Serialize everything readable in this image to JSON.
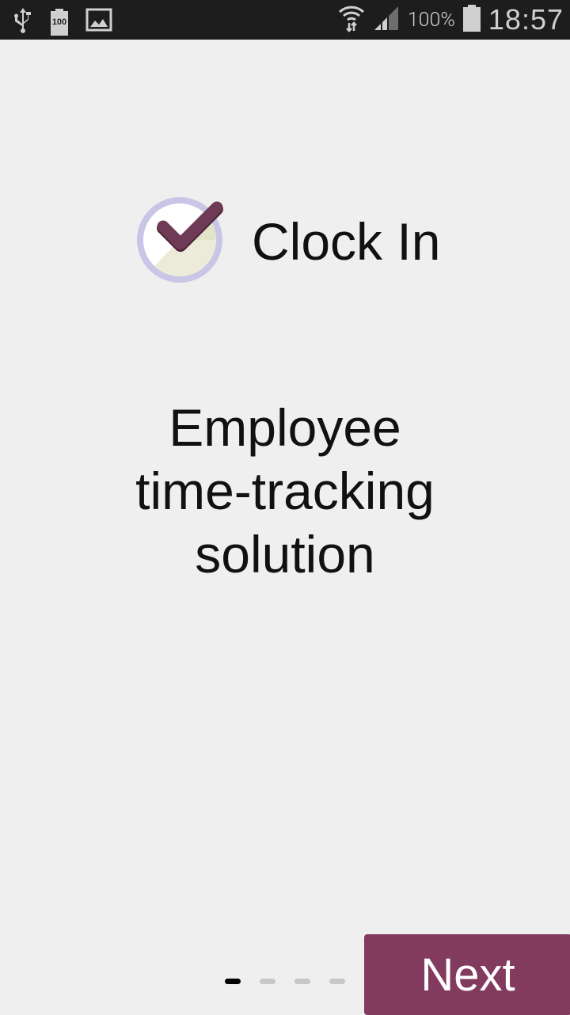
{
  "status_bar": {
    "left_icons": [
      "usb-icon",
      "battery-100-notification-icon",
      "image-icon"
    ],
    "battery_badge": "100",
    "right_icons": [
      "wifi-icon",
      "signal-icon",
      "battery-icon"
    ],
    "battery_percent": "100%",
    "time": "18:57"
  },
  "app": {
    "name": "Clock In",
    "logo": "checkmark-clock-icon"
  },
  "onboarding": {
    "tagline_lines": [
      "Employee",
      "time-tracking",
      "solution"
    ],
    "page_count": 4,
    "current_page": 1
  },
  "buttons": {
    "next_label": "Next"
  },
  "colors": {
    "accent": "#823b5f",
    "background": "#efefef",
    "status_bar": "#1d1d1d"
  }
}
